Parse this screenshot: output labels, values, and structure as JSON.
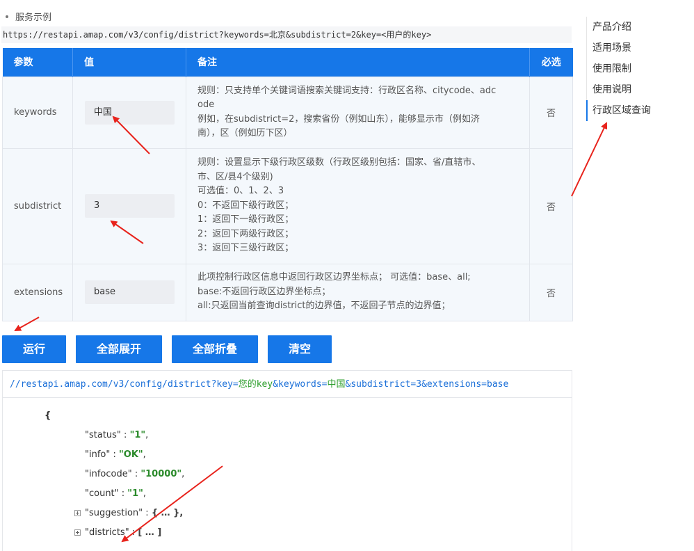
{
  "section": {
    "title": "服务示例"
  },
  "request_url": "https://restapi.amap.com/v3/config/district?keywords=北京&subdistrict=2&key=<用户的key>",
  "params_table": {
    "headers": [
      "参数",
      "值",
      "备注",
      "必选"
    ],
    "rows": [
      {
        "name": "keywords",
        "value": "中国",
        "note": [
          "规则：只支持单个关键词语搜索关键词支持：行政区名称、citycode、adc",
          "ode",
          "例如，在subdistrict=2，搜索省份（例如山东），能够显示市（例如济",
          "南），区（例如历下区）"
        ],
        "required": "否"
      },
      {
        "name": "subdistrict",
        "value": "3",
        "note": [
          "规则：设置显示下级行政区级数（行政区级别包括：国家、省/直辖市、",
          "市、区/县4个级别)",
          "可选值：0、1、2、3",
          "0：不返回下级行政区；",
          "1：返回下一级行政区；",
          "2：返回下两级行政区；",
          "3：返回下三级行政区；"
        ],
        "required": "否"
      },
      {
        "name": "extensions",
        "value": "base",
        "note": [
          "此项控制行政区信息中返回行政区边界坐标点；  可选值：base、all;",
          "base:不返回行政区边界坐标点；",
          "all:只返回当前查询district的边界值，不返回子节点的边界值；"
        ],
        "required": "否"
      }
    ]
  },
  "buttons": {
    "run": "运行",
    "expand_all": "全部展开",
    "collapse_all": "全部折叠",
    "clear": "清空"
  },
  "result": {
    "url_parts": [
      {
        "text": "//restapi.amap.com/v3/config/district?key=",
        "kind": "plain"
      },
      {
        "text": "您的key",
        "kind": "key"
      },
      {
        "text": "&keywords=",
        "kind": "plain"
      },
      {
        "text": "中国",
        "kind": "key"
      },
      {
        "text": "&subdistrict=3&extensions=base",
        "kind": "plain"
      }
    ],
    "json_open": "{",
    "fields": [
      {
        "key": "\"status\"",
        "sep": " : ",
        "value": "\"1\"",
        "tail": ","
      },
      {
        "key": "\"info\"",
        "sep": " : ",
        "value": "\"OK\"",
        "tail": ","
      },
      {
        "key": "\"infocode\"",
        "sep": " : ",
        "value": "\"10000\"",
        "tail": ","
      },
      {
        "key": "\"count\"",
        "sep": " : ",
        "value": "\"1\"",
        "tail": ","
      }
    ],
    "collapsed": [
      {
        "key": "\"suggestion\"",
        "sep": " : ",
        "value": "{ … },",
        "tail": ""
      },
      {
        "key": "\"districts\"",
        "sep": " : ",
        "value": "[ … ]",
        "tail": ""
      }
    ]
  },
  "side_nav": {
    "items": [
      "产品介绍",
      "适用场景",
      "使用限制",
      "使用说明",
      "行政区域查询"
    ],
    "active_index": 4
  },
  "colors": {
    "primary": "#1677e8",
    "annotation_arrow": "#e8231c",
    "json_string": "#2a8a2a"
  }
}
